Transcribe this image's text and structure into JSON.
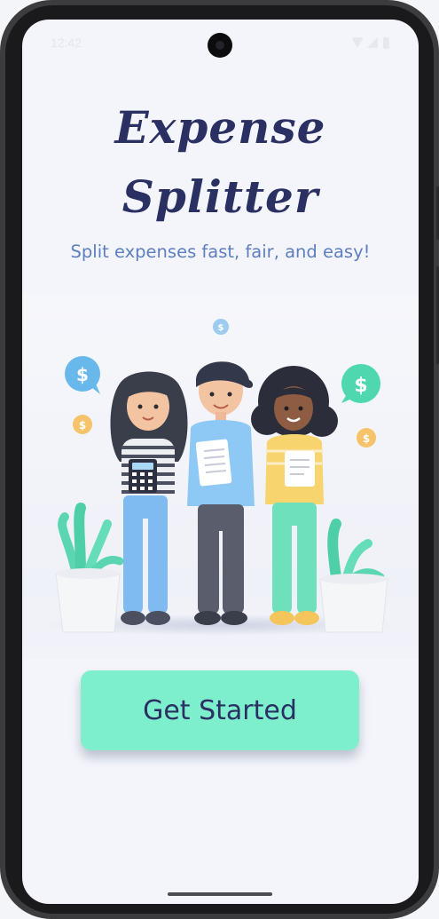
{
  "status_bar": {
    "time": "12:42",
    "icons": [
      "wifi-icon",
      "signal-icon",
      "battery-icon"
    ]
  },
  "app": {
    "title_line_1": "Expense",
    "title_line_2": "Splitter",
    "tagline": "Split expenses fast, fair, and easy!"
  },
  "hero": {
    "illustration": "three-people-splitting-bills",
    "coin_symbol": "$"
  },
  "actions": {
    "get_started_label": "Get Started"
  },
  "colors": {
    "title": "#2b3062",
    "tagline": "#5d7fc0",
    "button": "#7eefcd",
    "background": "#f4f5fb"
  }
}
